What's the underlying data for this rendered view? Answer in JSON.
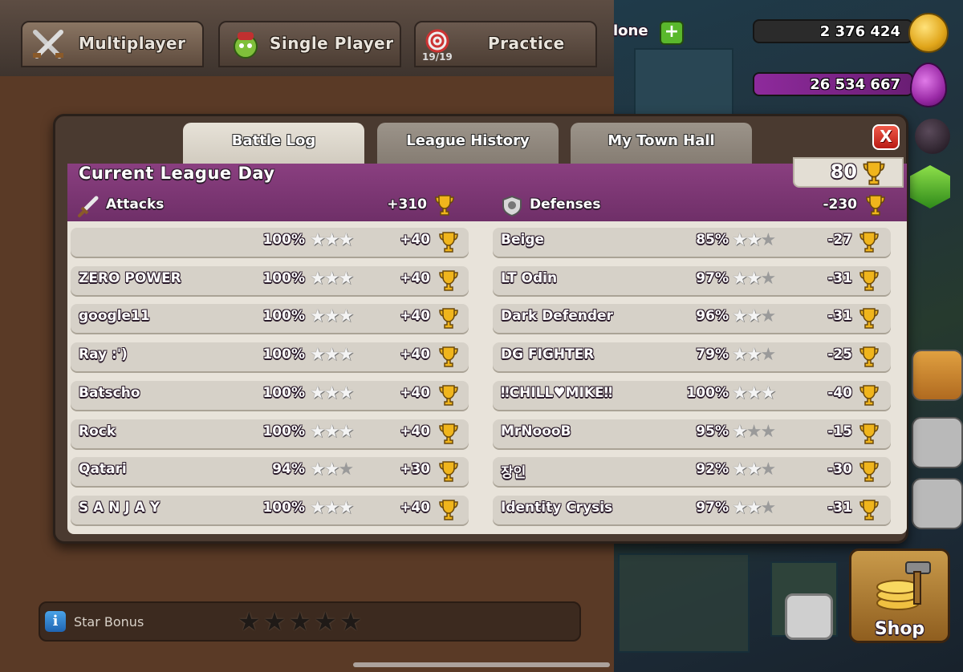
{
  "top_tabs": [
    {
      "label": "Multiplayer",
      "icon": "crossed-swords-icon",
      "active": true
    },
    {
      "label": "Single Player",
      "icon": "goblin-icon",
      "active": false
    },
    {
      "label": "Practice",
      "icon": "target-icon",
      "progress": "19/19",
      "active": false
    }
  ],
  "top_right": {
    "name_fragment": "lone",
    "gold": "2 376 424",
    "elixir": "26 534 667"
  },
  "modal_tabs": [
    "Battle Log",
    "League History",
    "My Town Hall"
  ],
  "close_label": "X",
  "league": {
    "title": "Current League Day",
    "trophies": "80",
    "attacks_label": "Attacks",
    "attacks_total": "+310",
    "defenses_label": "Defenses",
    "defenses_total": "-230"
  },
  "attacks": [
    {
      "name": "",
      "percent": "100%",
      "stars": 3,
      "trophies": "+40"
    },
    {
      "name": "ZERO POWER",
      "percent": "100%",
      "stars": 3,
      "trophies": "+40"
    },
    {
      "name": "google11",
      "percent": "100%",
      "stars": 3,
      "trophies": "+40"
    },
    {
      "name": "Ray :')",
      "percent": "100%",
      "stars": 3,
      "trophies": "+40"
    },
    {
      "name": "Batscho",
      "percent": "100%",
      "stars": 3,
      "trophies": "+40"
    },
    {
      "name": "Rock",
      "percent": "100%",
      "stars": 3,
      "trophies": "+40"
    },
    {
      "name": "Qatari",
      "percent": "94%",
      "stars": 2,
      "trophies": "+30"
    },
    {
      "name": "S A N J A Y",
      "percent": "100%",
      "stars": 3,
      "trophies": "+40"
    }
  ],
  "defenses": [
    {
      "name": "Beige",
      "percent": "85%",
      "stars": 2,
      "trophies": "-27"
    },
    {
      "name": "LT Odin",
      "percent": "97%",
      "stars": 2,
      "trophies": "-31"
    },
    {
      "name": "Dark Defender",
      "percent": "96%",
      "stars": 2,
      "trophies": "-31"
    },
    {
      "name": "DG FIGHTER",
      "percent": "79%",
      "stars": 2,
      "trophies": "-25"
    },
    {
      "name": "‼CHILL♥MIKE‼",
      "percent": "100%",
      "stars": 3,
      "trophies": "-40"
    },
    {
      "name": "MrNoooB",
      "percent": "95%",
      "stars": 1,
      "trophies": "-15"
    },
    {
      "name": "장인",
      "percent": "92%",
      "stars": 2,
      "trophies": "-30"
    },
    {
      "name": "Identity Crysis",
      "percent": "97%",
      "stars": 2,
      "trophies": "-31"
    }
  ],
  "star_bonus": {
    "label": "Star Bonus",
    "stars_earned": 0,
    "stars_total": 5
  },
  "shop_label": "Shop",
  "colors": {
    "header_purple": "#7a3573",
    "trophy_gold": "#f0b51c",
    "close_red": "#d9261c"
  }
}
